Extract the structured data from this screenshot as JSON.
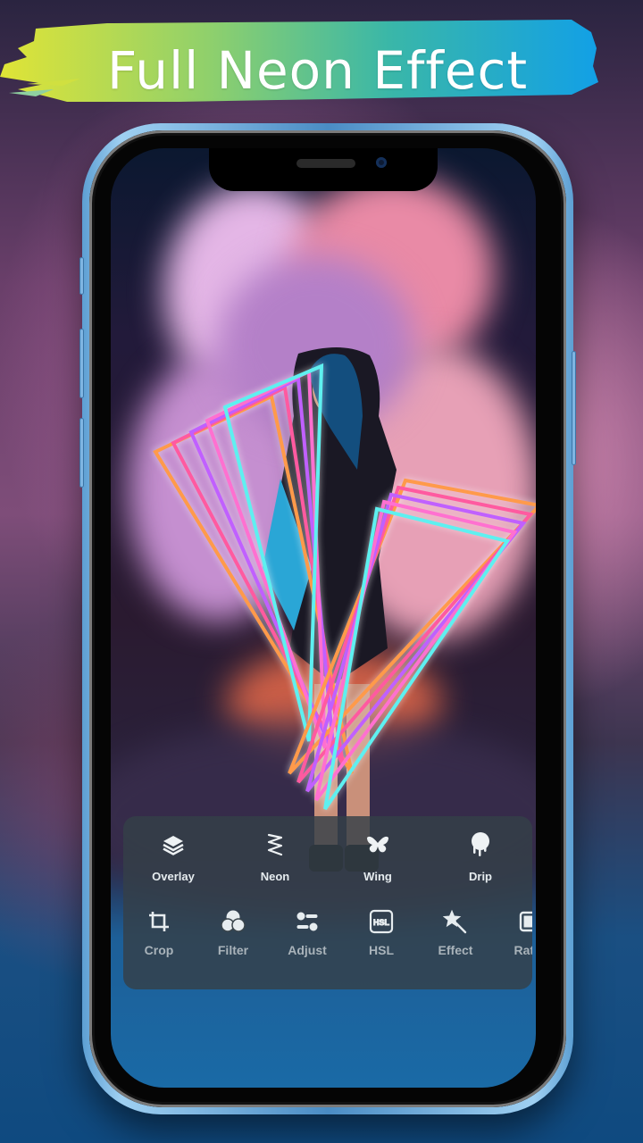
{
  "banner": {
    "title": "Full Neon Effect",
    "gradient_colors": [
      "#d8e33a",
      "#72c67e",
      "#1aa3e0"
    ]
  },
  "editor": {
    "image_description": "Woman with blue hair in black dress surrounded by pink smoke and rainbow neon triangle frame",
    "effect_tools": [
      {
        "label": "Overlay",
        "icon": "layers-icon"
      },
      {
        "label": "Neon",
        "icon": "neon-squiggle-icon"
      },
      {
        "label": "Wing",
        "icon": "butterfly-icon"
      },
      {
        "label": "Drip",
        "icon": "drip-icon"
      }
    ],
    "edit_tools": [
      {
        "label": "Crop",
        "icon": "crop-icon"
      },
      {
        "label": "Filter",
        "icon": "filter-circles-icon"
      },
      {
        "label": "Adjust",
        "icon": "adjust-sliders-icon"
      },
      {
        "label": "HSL",
        "icon": "hsl-icon"
      },
      {
        "label": "Effect",
        "icon": "magic-wand-icon"
      },
      {
        "label": "Ratio",
        "icon": "ratio-icon"
      }
    ],
    "hsl_badge": "HSL"
  },
  "colors": {
    "panel_bg": "#344048",
    "phone_frame": "#5d9fd3",
    "label_primary": "#e6ecef",
    "label_secondary": "#a9b3ba"
  }
}
